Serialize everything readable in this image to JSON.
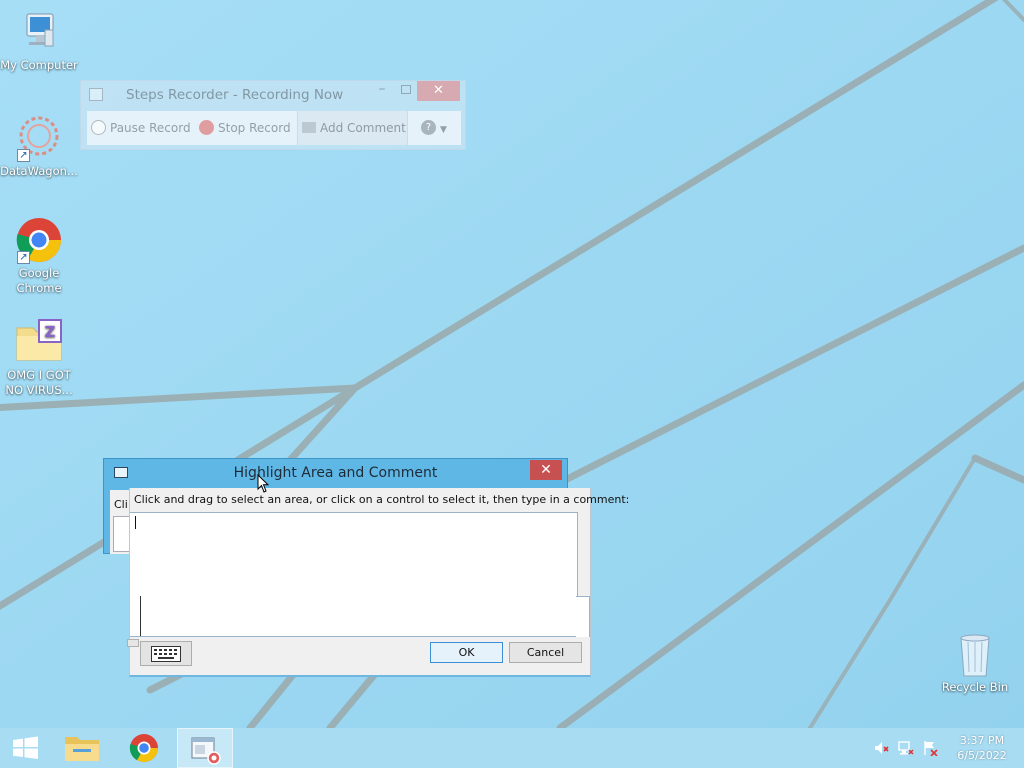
{
  "desktop": {
    "icons": [
      {
        "label": "My Computer",
        "icon": "computer-icon"
      },
      {
        "label": "DataWagon...",
        "icon": "datawagon-icon"
      },
      {
        "label": "Google Chrome",
        "icon": "chrome-icon"
      },
      {
        "label": "OMG I GOT NO VIRUS...",
        "icon": "zip-folder-icon"
      },
      {
        "label": "Recycle Bin",
        "icon": "recycle-bin-icon"
      }
    ]
  },
  "steps_recorder": {
    "title": "Steps Recorder - Recording Now",
    "pause_label": "Pause Record",
    "stop_label": "Stop Record",
    "add_comment_label": "Add Comment",
    "help_icon": "help-icon"
  },
  "highlight_dialog": {
    "title": "Highlight Area and Comment",
    "behind_label": "Cli",
    "instruction": "Click and drag to select an area, or click on a control to select it, then type in a comment:",
    "comment_value": "",
    "ok_label": "OK",
    "cancel_label": "Cancel",
    "keyboard_icon": "keyboard-icon"
  },
  "taskbar": {
    "items": [
      "start-icon",
      "file-explorer-icon",
      "chrome-icon",
      "steps-recorder-icon"
    ],
    "tray": [
      "volume-muted-icon",
      "network-icon",
      "action-center-icon"
    ],
    "time": "3:37 PM",
    "date": "6/5/2022"
  },
  "colors": {
    "wallpaper": "#9fd9f2",
    "dialog_title": "#5fb7e6",
    "close_button": "#c75050"
  }
}
